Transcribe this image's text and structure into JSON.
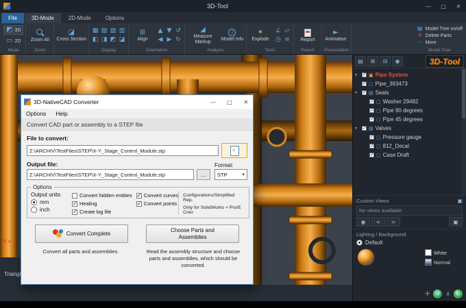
{
  "window": {
    "title": "3D-Tool",
    "controls": {
      "minimize": "—",
      "maximize": "□",
      "close": "✕"
    }
  },
  "tabs": [
    {
      "label": "File",
      "accent": true
    },
    {
      "label": "3D-Mode",
      "active": true
    },
    {
      "label": "2D-Mode"
    },
    {
      "label": "Options"
    }
  ],
  "ribbon": {
    "mode": {
      "label": "Mode",
      "btn_3d": "3D",
      "btn_2d": "2D"
    },
    "zoom": {
      "label": "Zoom",
      "zoom_all": "Zoom All"
    },
    "cross_section": {
      "button": "Cross Section"
    },
    "display": {
      "label": "Display"
    },
    "orientation": {
      "label": "Orientation",
      "align": "Align"
    },
    "analysis": {
      "label": "Analysis",
      "measure": "Measure Markup",
      "model_info": "Model Info"
    },
    "tools": {
      "label": "Tools",
      "explode": "Explode"
    },
    "report": {
      "label": "Report",
      "report": "Report"
    },
    "presentation": {
      "label": "Presentation",
      "animation": "Animation"
    },
    "model_tree_group": {
      "label": "Model Tree",
      "items": [
        {
          "label": "Model Tree on/off"
        },
        {
          "label": "Delete Parts"
        },
        {
          "label": "More"
        }
      ]
    }
  },
  "side_panel": {
    "logo": "3D-Tool",
    "toolbar_icons": [
      {
        "glyph": "▤"
      },
      {
        "glyph": "⊞"
      },
      {
        "glyph": "⊟"
      },
      {
        "glyph": "◉"
      }
    ],
    "tree": {
      "root": "Pipe System",
      "items": [
        {
          "label": "Pipe_393473"
        },
        {
          "label": "Seals",
          "folder": true
        },
        {
          "label": "Washer 29482",
          "child": true
        },
        {
          "label": "Pipe 90 degrees",
          "child": true
        },
        {
          "label": "Pipe 45 degrees",
          "child": true
        },
        {
          "label": "Valves",
          "folder": true
        },
        {
          "label": "Pressure gauge",
          "child": true
        },
        {
          "label": "812_Decal",
          "child": true
        },
        {
          "label": "Case Draft",
          "child": true
        }
      ]
    },
    "custom_views": {
      "label": "Custom Views",
      "empty": "No views available",
      "buttons": [
        {
          "glyph": "◉"
        },
        {
          "glyph": "<"
        },
        {
          "glyph": ">"
        },
        {
          "glyph": "▣",
          "last": true
        }
      ]
    },
    "lighting": {
      "label": "Lighting / Background",
      "default_option": "Default",
      "white": "White",
      "normal": "Normal"
    },
    "footer_icons": [
      {
        "glyph": "✛"
      },
      {
        "glyph": "↺",
        "green": true
      },
      {
        "glyph": "∧"
      },
      {
        "glyph": "↻",
        "green": true
      }
    ]
  },
  "canvas": {
    "status_left": "Triangles",
    "axis_label": "x",
    "axis_glyph": "✕"
  },
  "dialog": {
    "title": "3D-NativeCAD Converter",
    "controls": {
      "minimize": "—",
      "maximize": "□",
      "close": "✕"
    },
    "menu": [
      {
        "label": "Options"
      },
      {
        "label": "Help"
      }
    ],
    "info": "Convert CAD part or assembly to a STEP file",
    "file_to_convert": {
      "label": "File to convert:",
      "value": "Z:\\ARCHIV\\TestFiles\\STEP\\X-Y_Stage_Control_Module.stp"
    },
    "output_file": {
      "label": "Output file:",
      "value": "Z:\\ARCHIV\\TestFiles\\STEP\\X-Y_Stage_Control_Module.stp",
      "browse": "..."
    },
    "format": {
      "label": "Format:",
      "value": "STP",
      "caret": "▾"
    },
    "options": {
      "title": "Options",
      "units": {
        "label": "Output units",
        "options": [
          {
            "label": "mm",
            "selected": true
          },
          {
            "label": "inch"
          }
        ]
      },
      "checks_col1": [
        {
          "label": "Convert hidden entities"
        },
        {
          "label": "Healing",
          "checked": true
        },
        {
          "label": "Create log file",
          "checked": true
        }
      ],
      "checks_col2": [
        {
          "label": "Convert curves",
          "checked": true
        },
        {
          "label": "Convert points",
          "checked": true
        }
      ],
      "config_note_1": "Configurations/Simplified Rep.",
      "config_note_2": "Only for SolidWorks + Pro/E Creo"
    },
    "actions": {
      "convert_complete": "Convert Complete",
      "choose_parts": "Choose Parts and Assemblies",
      "convert_desc": "Convert all parts and assemblies.",
      "choose_desc": "Read the assembly structure and choose parts and assemblies, which should be converted."
    }
  },
  "colors": {
    "accent_orange": "#e8911f",
    "accent_blue": "#5fa8dc",
    "selected_red": "#e2503a"
  }
}
